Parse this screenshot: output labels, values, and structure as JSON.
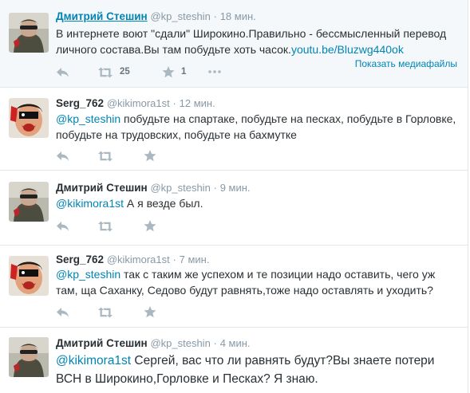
{
  "tweets": [
    {
      "fullname": "Дмитрий Стешин",
      "username": "@kp_steshin",
      "sep": "·",
      "time": "18 мин.",
      "text": "В интернете воют \"сдали\" Широкино.Правильно - бессмысленный перевод личного состава.Вы там побудьте хоть часок.",
      "link": "youtu.be/Bluzwg440ok",
      "retweets": "25",
      "favorites": "1",
      "media_label": "Показать медиафайлы"
    },
    {
      "fullname": "Serg_762",
      "username": "@kikimora1st",
      "sep": "·",
      "time": "12 мин.",
      "mention": "@kp_steshin",
      "text": " побудьте на спартаке, побудьте на песках, побудьте в Горловке, побудьте на трудовских, побудьте на бахмутке"
    },
    {
      "fullname": "Дмитрий Стешин",
      "username": "@kp_steshin",
      "sep": "·",
      "time": "9 мин.",
      "mention": "@kikimora1st",
      "text": " А я везде был."
    },
    {
      "fullname": "Serg_762",
      "username": "@kikimora1st",
      "sep": "·",
      "time": "7 мин.",
      "mention": "@kp_steshin",
      "text": " так с таким же успехом и те позиции надо оставить, чего уж там, ща Саханку, Седово будут равнять,тоже надо оставлять и уходить?"
    },
    {
      "fullname": "Дмитрий Стешин",
      "username": "@kp_steshin",
      "sep": "·",
      "time": "4 мин.",
      "mention": "@kikimora1st",
      "text": "  Сергей, вас что ли равнять будут?Вы знаете потери ВСН в Широкино,Горловке и Песках? Я знаю."
    }
  ],
  "icons": {
    "reply": "reply-icon",
    "retweet": "retweet-icon",
    "favorite": "star-icon"
  },
  "colors": {
    "link": "#0084b4",
    "muted": "#8899a6",
    "icon": "#aab8c2",
    "highlight_bg": "#f5f8fa"
  }
}
